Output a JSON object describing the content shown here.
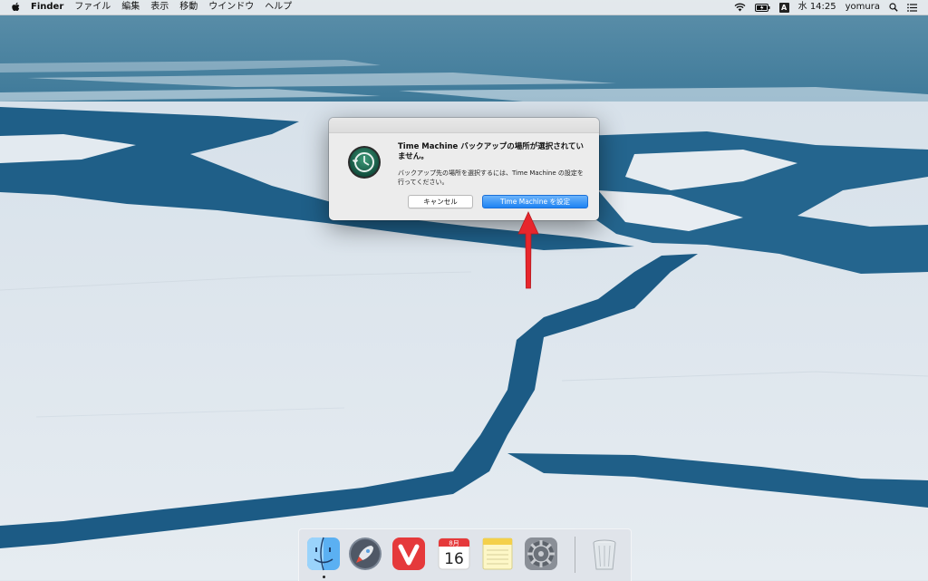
{
  "menubar": {
    "apple_icon": "apple-logo-icon",
    "app_name": "Finder",
    "menus": [
      "ファイル",
      "編集",
      "表示",
      "移動",
      "ウインドウ",
      "ヘルプ"
    ],
    "status": {
      "wifi_icon": "wifi-icon",
      "battery_icon": "battery-icon",
      "input_method": "A",
      "clock": "水 14:25",
      "user": "yomura",
      "search_icon": "spotlight-search-icon",
      "notification_icon": "notification-center-icon"
    }
  },
  "dialog": {
    "icon": "time-machine-icon",
    "title": "Time Machine バックアップの場所が選択されていません。",
    "message": "バックアップ先の場所を選択するには、Time Machine の設定を行ってください。",
    "cancel_label": "キャンセル",
    "setup_label": "Time Machine を設定"
  },
  "dock": {
    "items": [
      {
        "name": "Finder",
        "icon": "finder-icon"
      },
      {
        "name": "Launchpad",
        "icon": "launchpad-rocket-icon"
      },
      {
        "name": "Vivaldi",
        "icon": "vivaldi-icon"
      },
      {
        "name": "Calendar",
        "icon": "calendar-icon",
        "month": "8月",
        "day": "16"
      },
      {
        "name": "Notes",
        "icon": "notes-icon"
      },
      {
        "name": "System Preferences",
        "icon": "gear-icon"
      },
      {
        "name": "Trash",
        "icon": "trash-icon"
      }
    ]
  },
  "annotation": {
    "arrow_color": "#e8262c",
    "arrow_icon": "red-arrow-up-icon"
  },
  "colors": {
    "sky": "#3a7899",
    "water": "#1e5e88",
    "ice": "#e9eef3",
    "accent_button": "#1e83f3"
  }
}
